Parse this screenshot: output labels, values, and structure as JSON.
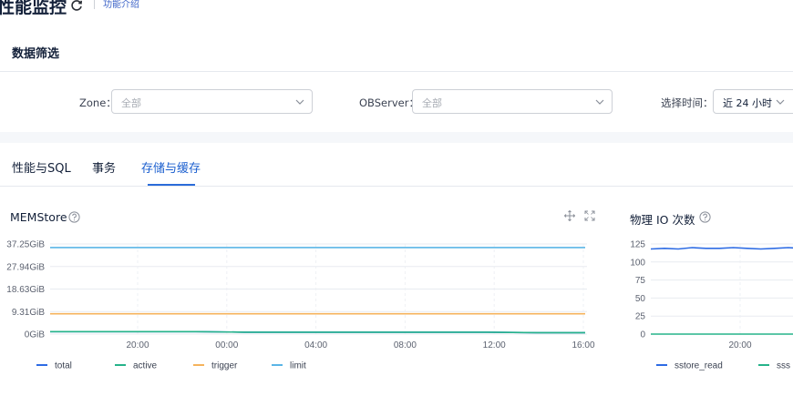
{
  "header": {
    "title": "性能监控",
    "intro_link": "功能介绍"
  },
  "filter": {
    "title": "数据筛选",
    "zone_label": "Zone：",
    "zone_value": "全部",
    "observer_label": "OBServer：",
    "observer_value": "全部",
    "time_label": "选择时间：",
    "time_value": "近 24 小时"
  },
  "tabs": [
    {
      "label": "性能与SQL",
      "active": false
    },
    {
      "label": "事务",
      "active": false
    },
    {
      "label": "存储与缓存",
      "active": true
    }
  ],
  "charts": {
    "memstore": {
      "title": "MEMStore"
    },
    "physical_io": {
      "title": "物理 IO 次数"
    }
  },
  "chart_data": [
    {
      "type": "line",
      "title": "MEMStore",
      "y_ticks": [
        "37.25GiB",
        "27.94GiB",
        "18.63GiB",
        "9.31GiB",
        "0GiB"
      ],
      "x_ticks": [
        "20:00",
        "00:00",
        "04:00",
        "08:00",
        "12:00",
        "16:00"
      ],
      "ylim_gib": [
        0,
        37.25
      ],
      "grid": true,
      "legend_position": "bottom",
      "series": [
        {
          "name": "total",
          "color": "#2d6be4",
          "values_gib": [
            1.0,
            1.0,
            1.0,
            1.0,
            0.8,
            0.8,
            0.8,
            0.8,
            0.8,
            0.8,
            0.6,
            0.6
          ]
        },
        {
          "name": "active",
          "color": "#26b38a",
          "values_gib": [
            1.0,
            1.0,
            1.0,
            1.0,
            0.8,
            0.8,
            0.8,
            0.8,
            0.8,
            0.8,
            0.6,
            0.6
          ]
        },
        {
          "name": "trigger",
          "color": "#f5b35c",
          "values_gib": [
            8.4,
            8.4,
            8.4,
            8.4,
            8.4,
            8.4,
            8.4,
            8.4,
            8.4,
            8.4,
            8.4,
            8.4
          ]
        },
        {
          "name": "limit",
          "color": "#5ab5e6",
          "values_gib": [
            35.8,
            35.8,
            35.8,
            35.8,
            35.8,
            35.8,
            35.8,
            35.8,
            35.8,
            35.8,
            35.8,
            35.8
          ]
        }
      ]
    },
    {
      "type": "line",
      "title": "物理 IO 次数",
      "y_ticks": [
        "125",
        "100",
        "75",
        "50",
        "25",
        "0"
      ],
      "x_ticks": [
        "20:00"
      ],
      "ylim": [
        0,
        125
      ],
      "grid": true,
      "legend_position": "bottom",
      "series": [
        {
          "name": "sstore_read",
          "color": "#2d6be4",
          "values": [
            118,
            119,
            118,
            120,
            119,
            119,
            120,
            119,
            118,
            119,
            120,
            119
          ]
        },
        {
          "name": "sss",
          "color": "#26b38a",
          "values": [
            0,
            0,
            0,
            0,
            0,
            0,
            0,
            0,
            0,
            0,
            0,
            0
          ]
        }
      ]
    }
  ]
}
